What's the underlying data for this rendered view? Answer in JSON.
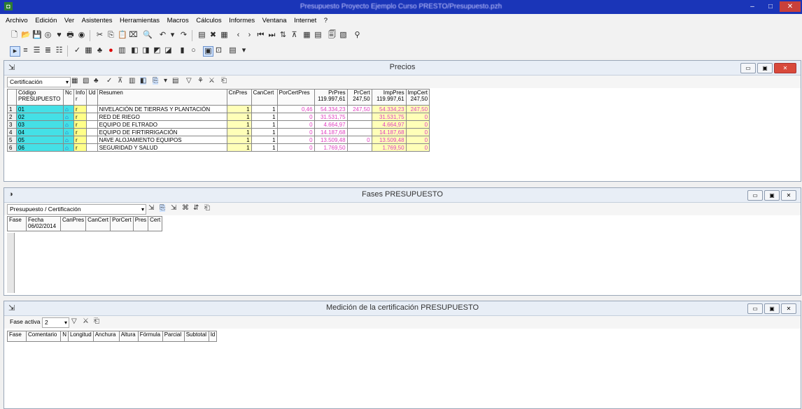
{
  "window": {
    "title": "Presupuesto Proyecto Ejemplo Curso PRESTO/Presupuesto.pzh",
    "minimize": "–",
    "maximize": "□",
    "close": "✕"
  },
  "menu": [
    "Archivo",
    "Edición",
    "Ver",
    "Asistentes",
    "Herramientas",
    "Macros",
    "Cálculos",
    "Informes",
    "Ventana",
    "Internet",
    "?"
  ],
  "precios": {
    "title": "Precios",
    "filter_value": "Certificación",
    "columns": [
      "Código PRESUPUESTO",
      "Nc",
      "Info r",
      "Ud",
      "Resumen",
      "CnPres",
      "CanCert",
      "PorCertPres",
      "PrPres 119.997,61",
      "PrCert 247,50",
      "ImpPres 119.997,61",
      "ImpCert 247,50"
    ],
    "rows": [
      {
        "n": "1",
        "code": "01",
        "nc": "⌂",
        "info": "r",
        "ud": "",
        "res": "NIVELACIÓN DE TIERRAS Y PLANTACIÓN",
        "cnp": "1",
        "cc": "1",
        "pcp": "0,46",
        "prp": "54.334,23",
        "prc": "247,50",
        "imp": "54.334,23",
        "imc": "247,50"
      },
      {
        "n": "2",
        "code": "02",
        "nc": "⌂",
        "info": "r",
        "ud": "",
        "res": "RED DE RIEGO",
        "cnp": "1",
        "cc": "1",
        "pcp": "0",
        "prp": "31.531,75",
        "prc": "",
        "imp": "31.531,75",
        "imc": "0"
      },
      {
        "n": "3",
        "code": "03",
        "nc": "⌂",
        "info": "r",
        "ud": "",
        "res": "EQUIPO DE FLTRADO",
        "cnp": "1",
        "cc": "1",
        "pcp": "0",
        "prp": "4.664,97",
        "prc": "",
        "imp": "4.664,97",
        "imc": "0"
      },
      {
        "n": "4",
        "code": "04",
        "nc": "⌂",
        "info": "r",
        "ud": "",
        "res": "EQUIPO DE FIRTIRRIGACIÓN",
        "cnp": "1",
        "cc": "1",
        "pcp": "0",
        "prp": "14.187,68",
        "prc": "",
        "imp": "14.187,68",
        "imc": "0"
      },
      {
        "n": "5",
        "code": "05",
        "nc": "⌂",
        "info": "r",
        "ud": "",
        "res": "NAVE ALOJAMIENTO EQUIPOS",
        "cnp": "1",
        "cc": "1",
        "pcp": "0",
        "prp": "13.509,48",
        "prc": "0",
        "imp": "13.509,48",
        "imc": "0"
      },
      {
        "n": "6",
        "code": "06",
        "nc": "⌂",
        "info": "r",
        "ud": "",
        "res": "SEGURIDAD Y SALUD",
        "cnp": "1",
        "cc": "1",
        "pcp": "0",
        "prp": "1.769,50",
        "prc": "",
        "imp": "1.769,50",
        "imc": "0"
      }
    ]
  },
  "fases": {
    "title": "Fases PRESUPUESTO",
    "filter_value": "Presupuesto / Certificación",
    "columns": [
      "Fase",
      "Fecha 06/02/2014",
      "CanPres",
      "CanCert",
      "PorCert",
      "Pres",
      "Cert"
    ]
  },
  "medicion": {
    "title": "Medición de la certificación  PRESUPUESTO",
    "fase_label": "Fase activa",
    "fase_value": "2",
    "columns": [
      "Fase",
      "Comentario",
      "N",
      "Longitud",
      "Anchura",
      "Altura",
      "Fórmula",
      "Parcial",
      "Subtotal",
      "Id"
    ]
  }
}
